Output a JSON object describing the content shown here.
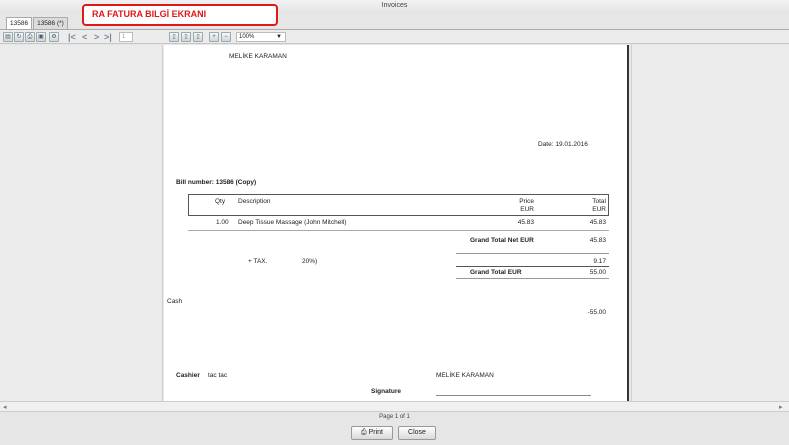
{
  "window": {
    "title": "Invoices"
  },
  "annotation": {
    "label": "RA FATURA BILGİ EKRANI"
  },
  "tabs": [
    {
      "label": "13586"
    },
    {
      "label": "13586 (*)"
    }
  ],
  "toolbar": {
    "page_input": "1",
    "zoom": "100%",
    "icons": [
      "export-icon",
      "refresh-icon",
      "print-icon",
      "save-icon",
      "settings-icon",
      "first-page-icon",
      "prev-page-icon",
      "next-page-icon",
      "last-page-icon",
      "single-page-icon",
      "two-page-icon",
      "continuous-page-icon",
      "zoom-in-icon",
      "zoom-out-icon"
    ]
  },
  "invoice": {
    "company": "MELİKE KARAMAN",
    "date": "Date: 19.01.2016",
    "bill_number": "Bill number: 13586  (Copy)",
    "headers": {
      "qty": "Qty",
      "description": "Description",
      "price": "Price",
      "price_cur": "EUR",
      "total": "Total",
      "total_cur": "EUR"
    },
    "items": [
      {
        "qty": "1.00",
        "description": "Deep Tissue Massage (John Mitchell)",
        "price": "45.83",
        "total": "45.83"
      }
    ],
    "grand_total_net_label": "Grand Total Net EUR",
    "grand_total_net": "45.83",
    "tax_label": "+ TAX.",
    "tax_rate": "20%)",
    "tax_value": "9.17",
    "grand_total_label": "Grand Total EUR",
    "grand_total": "55.00",
    "payment_method": "Cash",
    "payment_amount": "-55.00",
    "cashier_label": "Cashier",
    "cashier_name": "tac tac",
    "signer_name": "MELİKE KARAMAN",
    "signature_label": "Signature"
  },
  "footer": {
    "page_info": "Page 1 of 1",
    "print_label": "Print",
    "close_label": "Close"
  }
}
